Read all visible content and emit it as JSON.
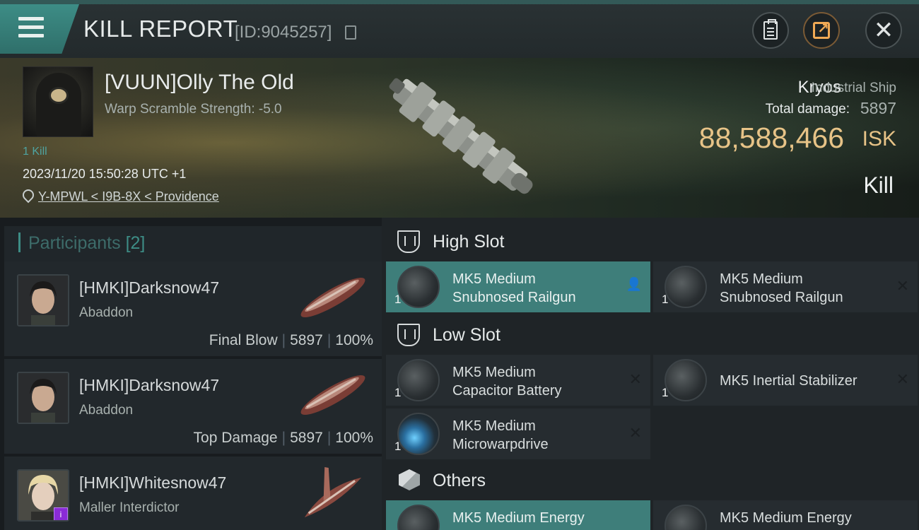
{
  "header": {
    "title": "KILL REPORT",
    "report_id": "[ID:9045257]"
  },
  "victim": {
    "name": "[VUUN]Olly The Old",
    "warp_scramble": "Warp Scramble Strength: -5.0",
    "kill_count": "1 Kill",
    "datetime": "2023/11/20 15:50:28 UTC +1",
    "location": "Y-MPWL < I9B-8X < Providence",
    "ship_name": "Kryos",
    "ship_class": "Industrial Ship",
    "total_damage_label": "Total damage:",
    "total_damage": "5897",
    "isk_value": "88,588,466",
    "isk_unit": "ISK",
    "result": "Kill"
  },
  "participants": {
    "title": "Participants",
    "count": "[2]",
    "items": [
      {
        "name": "[HMKI]Darksnow47",
        "ship": "Abaddon",
        "role": "Final Blow",
        "damage": "5897",
        "percent": "100%"
      },
      {
        "name": "[HMKI]Darksnow47",
        "ship": "Abaddon",
        "role": "Top Damage",
        "damage": "5897",
        "percent": "100%"
      },
      {
        "name": "[HMKI]Whitesnow47",
        "ship": "Maller Interdictor",
        "badge": "i"
      }
    ]
  },
  "slots": {
    "high": {
      "title": "High Slot",
      "modules": [
        {
          "qty": "1",
          "name_line1": "MK5 Medium",
          "name_line2": "Snubnosed Railgun"
        },
        {
          "qty": "1",
          "name_line1": "MK5 Medium",
          "name_line2": "Snubnosed Railgun"
        }
      ]
    },
    "low": {
      "title": "Low Slot",
      "modules": [
        {
          "qty": "1",
          "name_line1": "MK5 Medium",
          "name_line2": "Capacitor Battery"
        },
        {
          "qty": "1",
          "name_line1": "MK5 Inertial Stabilizer",
          "name_line2": ""
        },
        {
          "qty": "1",
          "name_line1": "MK5 Medium",
          "name_line2": "Microwarpdrive"
        }
      ]
    },
    "others": {
      "title": "Others",
      "modules": [
        {
          "name_line1": "MK5 Medium Energy"
        },
        {
          "name_line1": "MK5 Medium Energy"
        }
      ]
    }
  },
  "icons": {
    "menu": "menu-icon",
    "copy": "copy-icon",
    "clipboard": "clipboard-icon",
    "share": "share-icon",
    "close": "close-icon",
    "location": "location-pin-icon",
    "slot": "shield-slot-icon",
    "others": "cube-icon"
  },
  "colors": {
    "accent": "#3d8d86",
    "isk": "#e7c387",
    "selected_module": "#3e7e7a",
    "share_orange": "#f0a955"
  }
}
